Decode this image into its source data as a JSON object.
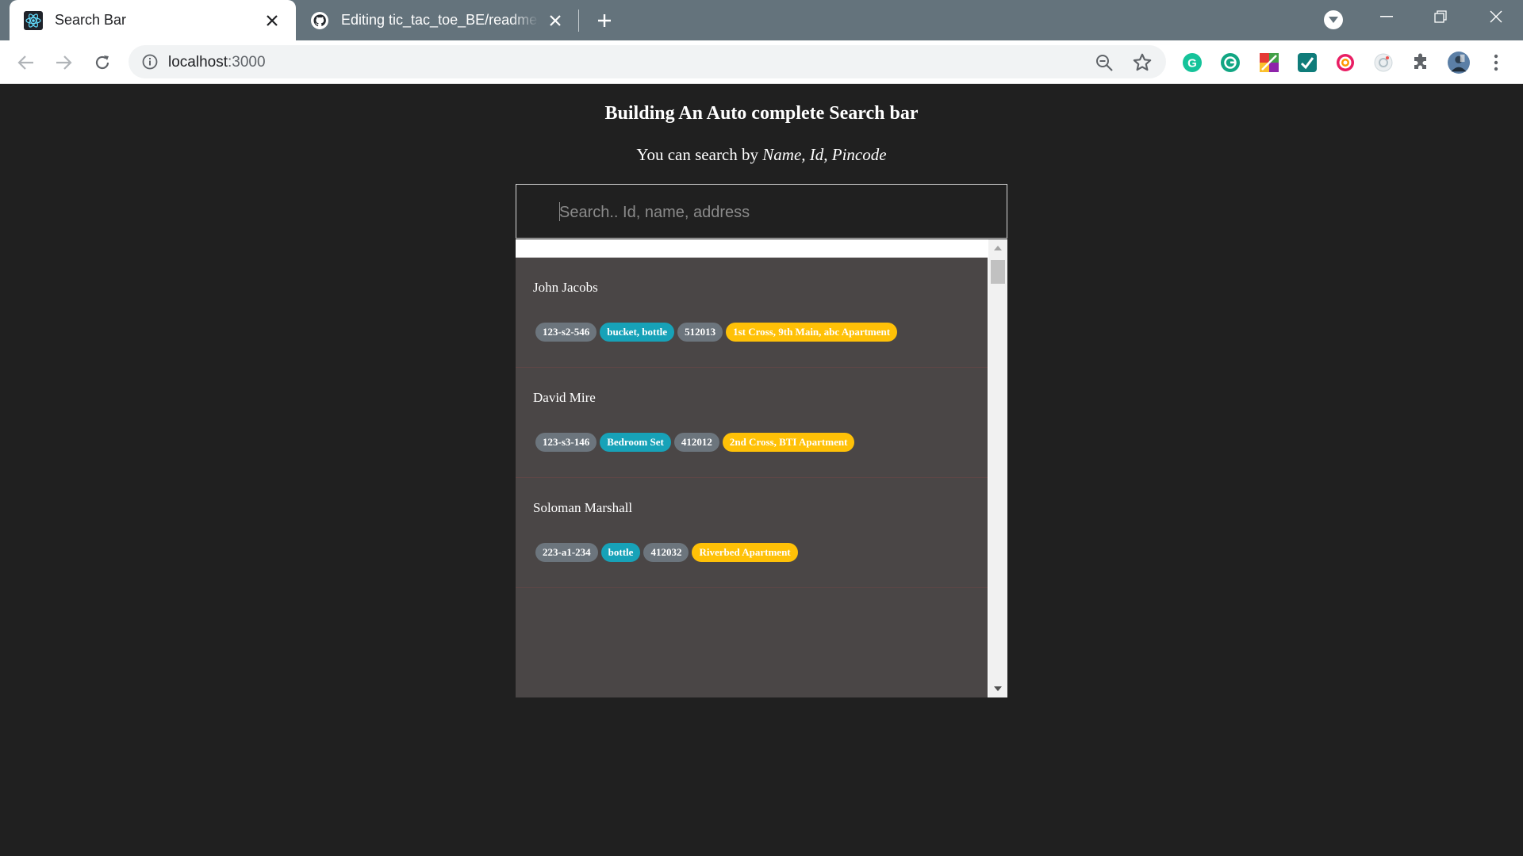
{
  "browser": {
    "tabs": [
      {
        "title": "Search Bar",
        "icon": "react-icon",
        "active": true
      },
      {
        "title": "Editing tic_tac_toe_BE/readme.md",
        "icon": "github-icon",
        "active": false
      }
    ],
    "url_host": "localhost",
    "url_port": ":3000"
  },
  "page": {
    "heading": "Building An Auto complete Search bar",
    "subheading_prefix": "You can search by",
    "subheading_fields": "Name, Id, Pincode",
    "search_placeholder": "Search.. Id, name, address"
  },
  "results": [
    {
      "name": "John Jacobs",
      "id": "123-s2-546",
      "items": "bucket, bottle",
      "pincode": "512013",
      "address": "1st Cross, 9th Main, abc Apartment"
    },
    {
      "name": "David Mire",
      "id": "123-s3-146",
      "items": "Bedroom Set",
      "pincode": "412012",
      "address": "2nd Cross, BTI Apartment"
    },
    {
      "name": "Soloman Marshall",
      "id": "223-a1-234",
      "items": "bottle",
      "pincode": "412032",
      "address": "Riverbed Apartment"
    }
  ],
  "colors": {
    "badge_id": "#6c757d",
    "badge_items": "#17a2b8",
    "badge_pincode": "#6c757d",
    "badge_address": "#ffc107",
    "page_bg": "#202020",
    "results_bg": "#4a4646"
  }
}
